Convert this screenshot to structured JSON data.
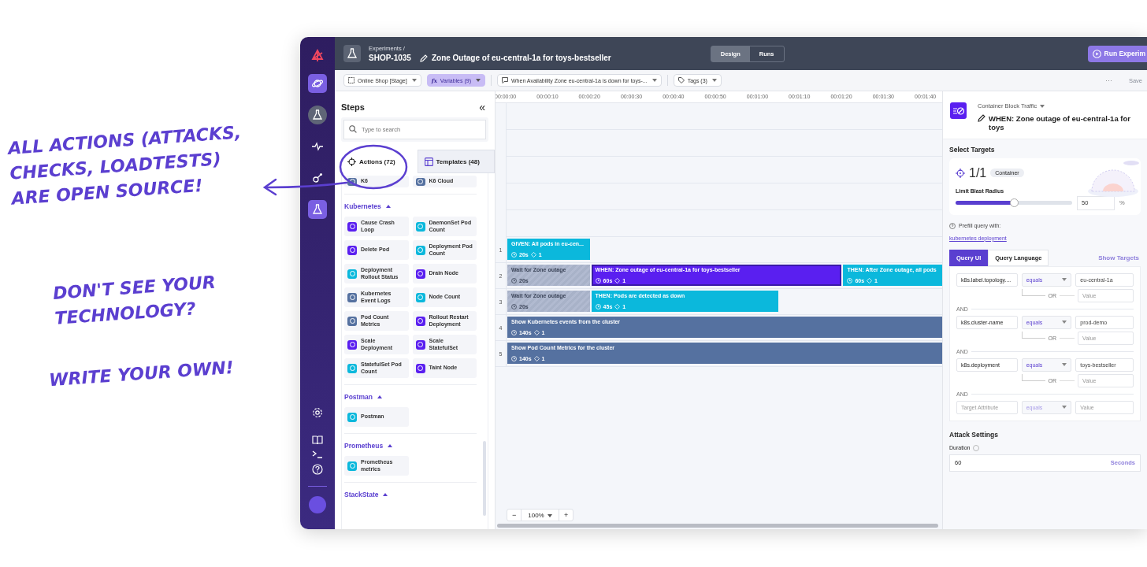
{
  "annotations": [
    {
      "text": "ALL ACTIONS (ATTACKS,\nCHECKS, LOADTESTS)\nARE OPEN SOURCE!"
    },
    {
      "text": "DON'T SEE YOUR\nTECHNOLOGY?"
    },
    {
      "text": "WRITE YOUR OWN!"
    }
  ],
  "rail": {
    "items": [
      {
        "kind": "planet",
        "selected": true
      },
      {
        "kind": "flask-round",
        "selected": false
      },
      {
        "kind": "pulse",
        "selected": false
      },
      {
        "kind": "nodes",
        "selected": false
      },
      {
        "kind": "flask",
        "selected": true
      }
    ]
  },
  "header": {
    "breadcrumb": "Experiments /",
    "key": "SHOP-1035",
    "title": "Zone Outage of eu-central-1a for toys-bestseller",
    "modes": [
      {
        "label": "Design",
        "selected": true
      },
      {
        "label": "Runs",
        "selected": false
      }
    ],
    "run_button": "Run Experim"
  },
  "toolbar": {
    "environment": "Online Shop [Stage]",
    "variables_prefix": "fx",
    "variables": "Variables (9)",
    "hypothesis": "When Availability Zone eu-central-1a is down for toys-...",
    "tags": "Tags (3)",
    "more": "···",
    "save": "Save"
  },
  "steps": {
    "title": "Steps",
    "collapse": "«",
    "search": {
      "placeholder": "Type to search"
    },
    "tabs": [
      {
        "label": "Actions (72)",
        "selected": true
      },
      {
        "label": "Templates (48)",
        "selected": false
      }
    ],
    "top_items": [
      {
        "label": "K6",
        "kind": "other"
      },
      {
        "label": "K6 Cloud",
        "kind": "other"
      }
    ],
    "groups": [
      {
        "name": "Kubernetes",
        "expanded": true,
        "items": [
          {
            "label": "Cause Crash Loop",
            "kind": "attack"
          },
          {
            "label": "DaemonSet Pod Count",
            "kind": "check"
          },
          {
            "label": "Delete Pod",
            "kind": "attack"
          },
          {
            "label": "Deployment Pod Count",
            "kind": "check"
          },
          {
            "label": "Deployment Rollout Status",
            "kind": "check"
          },
          {
            "label": "Drain Node",
            "kind": "attack"
          },
          {
            "label": "Kubernetes Event Logs",
            "kind": "other"
          },
          {
            "label": "Node Count",
            "kind": "check"
          },
          {
            "label": "Pod Count Metrics",
            "kind": "other"
          },
          {
            "label": "Rollout Restart Deployment",
            "kind": "attack"
          },
          {
            "label": "Scale Deployment",
            "kind": "attack"
          },
          {
            "label": "Scale StatefulSet",
            "kind": "attack"
          },
          {
            "label": "StatefulSet Pod Count",
            "kind": "check"
          },
          {
            "label": "Taint Node",
            "kind": "attack"
          }
        ]
      },
      {
        "name": "Postman",
        "expanded": true,
        "items": [
          {
            "label": "Postman",
            "kind": "check"
          }
        ]
      },
      {
        "name": "Prometheus",
        "expanded": true,
        "items": [
          {
            "label": "Prometheus metrics",
            "kind": "check"
          }
        ]
      },
      {
        "name": "StackState",
        "expanded": true
      }
    ]
  },
  "timeline": {
    "ticks": [
      "00:00:00",
      "00:00:10",
      "00:00:20",
      "00:00:30",
      "00:00:40",
      "00:00:50",
      "00:01:00",
      "00:01:10",
      "00:01:20",
      "00:01:30",
      "00:01:40"
    ],
    "rows": [
      {
        "number": "1",
        "blocks": [
          {
            "kind": "given",
            "label": "GIVEN: All pods in eu-cen...",
            "duration": "20s",
            "count": "1",
            "selected": false
          }
        ]
      },
      {
        "number": "2",
        "blocks": [
          {
            "kind": "wait",
            "label": "Wait for Zone outage",
            "duration": "20s",
            "selected": false
          },
          {
            "kind": "when",
            "label": "WHEN: Zone outage of eu-central-1a for toys-bestseller",
            "duration": "60s",
            "count": "1",
            "selected": true
          },
          {
            "kind": "then",
            "label": "THEN: After Zone outage, all pods",
            "duration": "60s",
            "count": "1",
            "selected": false
          }
        ]
      },
      {
        "number": "3",
        "blocks": [
          {
            "kind": "wait",
            "label": "Wait for Zone outage",
            "duration": "20s",
            "selected": false
          },
          {
            "kind": "then",
            "label": "THEN: Pods are detected as down",
            "duration": "45s",
            "count": "1",
            "selected": false
          }
        ]
      },
      {
        "number": "4",
        "blocks": [
          {
            "kind": "check",
            "label": "Show Kubernetes events from the cluster",
            "duration": "140s",
            "count": "1",
            "selected": false
          }
        ]
      },
      {
        "number": "5",
        "blocks": [
          {
            "kind": "check",
            "label": "Show Pod Count Metrics for the cluster",
            "duration": "140s",
            "count": "1",
            "selected": false
          }
        ]
      }
    ],
    "zoom": {
      "minus": "−",
      "value": "100%",
      "plus": "+"
    }
  },
  "details": {
    "action_type": "Container Block Traffic",
    "step_title": "WHEN: Zone outage of eu-central-1a for toys",
    "section": "Select Targets",
    "target_count": "**1**/1",
    "target_badge": "Container",
    "blast_label": "Limit Blast Radius",
    "blast": {
      "level": 0.5
    },
    "blast_value": "50",
    "blast_unit": "%",
    "prefill_label": "Prefill query with:",
    "prefill_link": "kubernetes deployment",
    "query_tabs": [
      {
        "label": "Query UI",
        "selected": true
      },
      {
        "label": "Query Language",
        "selected": false
      }
    ],
    "show_targets": "Show Targets",
    "conditions": [
      {
        "attribute": "k8s.label.topology....",
        "operator": "equals",
        "value": "eu-central-1a",
        "or_label": "OR",
        "or_placeholder": "Value",
        "disabled": false
      },
      {
        "join": "AND",
        "attribute": "k8s.cluster-name",
        "operator": "equals",
        "value": "prod-demo",
        "or_label": "OR",
        "or_placeholder": "Value",
        "disabled": false
      },
      {
        "join": "AND",
        "attribute": "k8s.deployment",
        "operator": "equals",
        "value": "toys-bestseller",
        "or_label": "OR",
        "or_placeholder": "Value",
        "disabled": false
      },
      {
        "join": "AND",
        "attribute_placeholder": "Target Attribute",
        "operator": "equals",
        "value_placeholder": "Value",
        "disabled": true
      }
    ],
    "attack_settings": "Attack Settings",
    "duration_label": "Duration",
    "duration_value": "60",
    "duration_unit": "Seconds"
  }
}
